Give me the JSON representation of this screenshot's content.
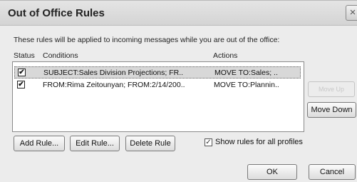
{
  "window": {
    "title": "Out of Office Rules",
    "close_symbol": "×"
  },
  "intro_text": "These rules will be applied to incoming messages while you are out of the office:",
  "list": {
    "headers": {
      "status": "Status",
      "conditions": "Conditions",
      "actions": "Actions"
    },
    "rows": [
      {
        "checked": true,
        "check_symbol": "✔",
        "conditions": "SUBJECT:Sales Division Projections; FR..",
        "actions": "MOVE TO:Sales; ..",
        "selected": true
      },
      {
        "checked": true,
        "check_symbol": "✔",
        "conditions": "FROM:Rima Zeitounyan; FROM:2/14/200..",
        "actions": "MOVE TO:Plannin..",
        "selected": false
      }
    ]
  },
  "buttons": {
    "move_up": "Move Up",
    "move_down": "Move Down",
    "add_rule": "Add Rule...",
    "edit_rule": "Edit Rule...",
    "delete_rule": "Delete Rule",
    "ok": "OK",
    "cancel": "Cancel"
  },
  "show_all_profiles": {
    "label": "Show rules for all profiles",
    "checked": true,
    "check_symbol": "✓"
  }
}
